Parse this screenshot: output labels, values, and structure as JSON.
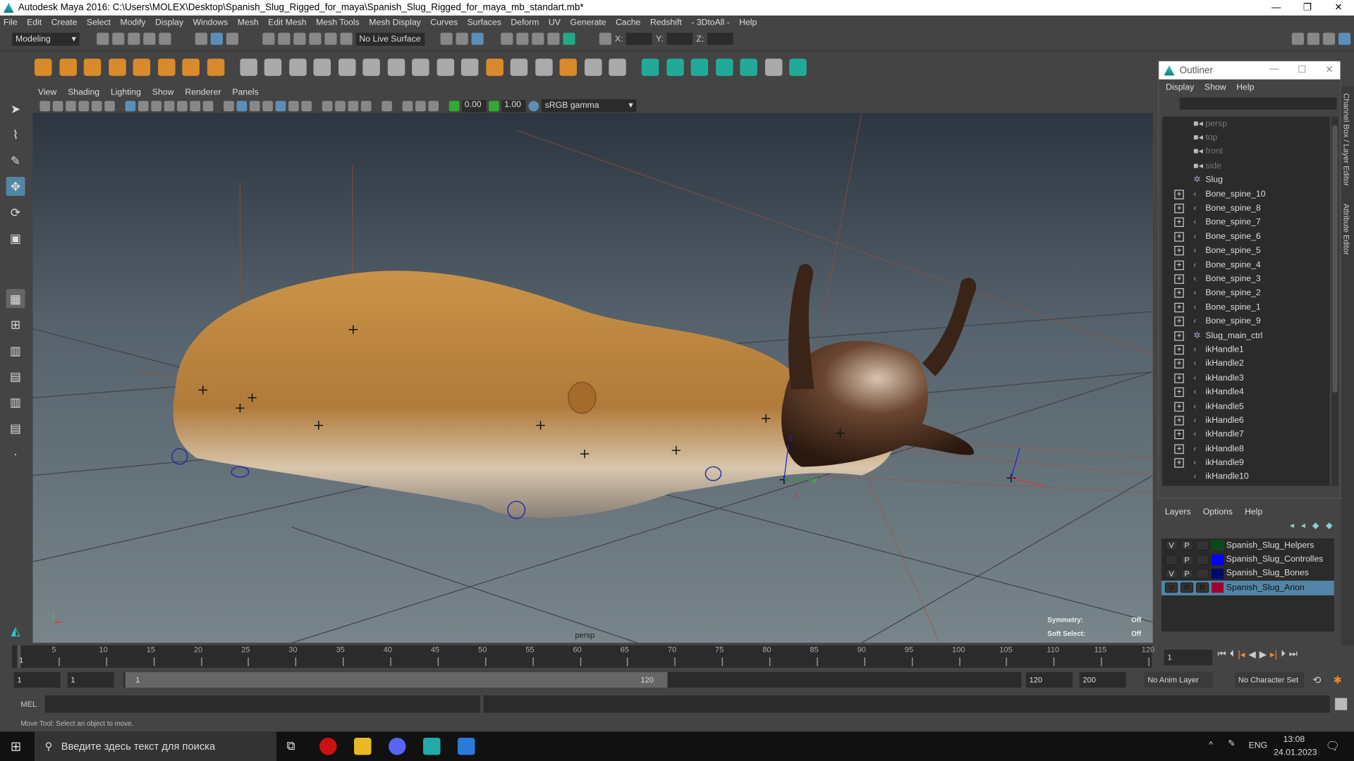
{
  "title": "Autodesk Maya 2016: C:\\Users\\MOLEX\\Desktop\\Spanish_Slug_Rigged_for_maya\\Spanish_Slug_Rigged_for_maya_mb_standart.mb*",
  "window_buttons": [
    "—",
    "❐",
    "✕"
  ],
  "menu": [
    "File",
    "Edit",
    "Create",
    "Select",
    "Modify",
    "Display",
    "Windows",
    "Mesh",
    "Edit Mesh",
    "Mesh Tools",
    "Mesh Display",
    "Curves",
    "Surfaces",
    "Deform",
    "UV",
    "Generate",
    "Cache",
    "Redshift",
    "- 3DtoAll -",
    "Help"
  ],
  "status": {
    "mode": "Modeling",
    "live_surface": "No Live Surface",
    "x_label": "X:",
    "y_label": "Y:",
    "z_label": "Z:"
  },
  "panel": {
    "menu": [
      "View",
      "Shading",
      "Lighting",
      "Show",
      "Renderer",
      "Panels"
    ],
    "exposure": "0.00",
    "gamma": "1.00",
    "color_space": "sRGB gamma"
  },
  "viewport": {
    "camera": "persp",
    "symmetry_label": "Symmetry:",
    "symmetry_value": "Off",
    "soft_select_label": "Soft Select:",
    "soft_select_value": "Off",
    "axis_labels": {
      "x": "x",
      "y": "y",
      "z": "z"
    }
  },
  "outliner": {
    "title": "Outliner",
    "menu": [
      "Display",
      "Show",
      "Help"
    ],
    "items": [
      {
        "label": "persp",
        "icon": "camera-icon",
        "expand": false,
        "dim": true
      },
      {
        "label": "top",
        "icon": "camera-icon",
        "expand": false,
        "dim": true
      },
      {
        "label": "front",
        "icon": "camera-icon",
        "expand": false,
        "dim": true
      },
      {
        "label": "side",
        "icon": "camera-icon",
        "expand": false,
        "dim": true
      },
      {
        "label": "Slug",
        "icon": "mesh-icon",
        "expand": false,
        "dim": false
      },
      {
        "label": "Bone_spine_10",
        "icon": "joint-icon",
        "expand": true,
        "dim": false
      },
      {
        "label": "Bone_spine_8",
        "icon": "joint-icon",
        "expand": true,
        "dim": false
      },
      {
        "label": "Bone_spine_7",
        "icon": "joint-icon",
        "expand": true,
        "dim": false
      },
      {
        "label": "Bone_spine_6",
        "icon": "joint-icon",
        "expand": true,
        "dim": false
      },
      {
        "label": "Bone_spine_5",
        "icon": "joint-icon",
        "expand": true,
        "dim": false
      },
      {
        "label": "Bone_spine_4",
        "icon": "joint-icon",
        "expand": true,
        "dim": false
      },
      {
        "label": "Bone_spine_3",
        "icon": "joint-icon",
        "expand": true,
        "dim": false
      },
      {
        "label": "Bone_spine_2",
        "icon": "joint-icon",
        "expand": true,
        "dim": false
      },
      {
        "label": "Bone_spine_1",
        "icon": "joint-icon",
        "expand": true,
        "dim": false
      },
      {
        "label": "Bone_spine_9",
        "icon": "joint-icon",
        "expand": true,
        "dim": false
      },
      {
        "label": "Slug_main_ctrl",
        "icon": "mesh-icon",
        "expand": true,
        "dim": false
      },
      {
        "label": "ikHandle1",
        "icon": "ik-handle-icon",
        "expand": true,
        "dim": false
      },
      {
        "label": "ikHandle2",
        "icon": "ik-handle-icon",
        "expand": true,
        "dim": false
      },
      {
        "label": "ikHandle3",
        "icon": "ik-handle-icon",
        "expand": true,
        "dim": false
      },
      {
        "label": "ikHandle4",
        "icon": "ik-handle-icon",
        "expand": true,
        "dim": false
      },
      {
        "label": "ikHandle5",
        "icon": "ik-handle-icon",
        "expand": true,
        "dim": false
      },
      {
        "label": "ikHandle6",
        "icon": "ik-handle-icon",
        "expand": true,
        "dim": false
      },
      {
        "label": "ikHandle7",
        "icon": "ik-handle-icon",
        "expand": true,
        "dim": false
      },
      {
        "label": "ikHandle8",
        "icon": "ik-handle-icon",
        "expand": true,
        "dim": false
      },
      {
        "label": "ikHandle9",
        "icon": "ik-handle-icon",
        "expand": true,
        "dim": false
      },
      {
        "label": "ikHandle10",
        "icon": "ik-handle-icon",
        "expand": false,
        "dim": false
      }
    ]
  },
  "layers": {
    "menu": [
      "Layers",
      "Options",
      "Help"
    ],
    "rows": [
      {
        "v": "V",
        "p": "P",
        "r": "",
        "name": "Spanish_Slug_Helpers",
        "color": "#0b4a1c",
        "selected": false
      },
      {
        "v": "",
        "p": "P",
        "r": "",
        "name": "Spanish_Slug_Controlles",
        "color": "#0000ff",
        "selected": false
      },
      {
        "v": "V",
        "p": "P",
        "r": "",
        "name": "Spanish_Slug_Bones",
        "color": "#000a6e",
        "selected": false
      },
      {
        "v": "V",
        "p": "P",
        "r": "R",
        "name": "Spanish_Slug_Arion",
        "color": "#a00030",
        "selected": true
      }
    ]
  },
  "side_tabs": [
    "Channel Box / Layer Editor",
    "Attribute Editor"
  ],
  "timeline": {
    "start": 1,
    "end": 120,
    "ticks": [
      5,
      10,
      15,
      20,
      25,
      30,
      35,
      40,
      45,
      50,
      55,
      60,
      65,
      70,
      75,
      80,
      85,
      90,
      95,
      100,
      105,
      110,
      115,
      120
    ],
    "current_frame": "1",
    "current_marker": "1"
  },
  "range": {
    "start": "1",
    "anim_start": "1",
    "slider_start": "1",
    "slider_end": "120",
    "end": "120",
    "anim_end": "200",
    "anim_layer": "No Anim Layer",
    "character_set": "No Character Set"
  },
  "mel": {
    "label": "MEL"
  },
  "help_line": "Move Tool: Select an object to move.",
  "taskbar": {
    "search_placeholder": "Введите здесь текст для поиска",
    "lang": "ENG",
    "time": "13:08",
    "date": "24.01.2023"
  }
}
